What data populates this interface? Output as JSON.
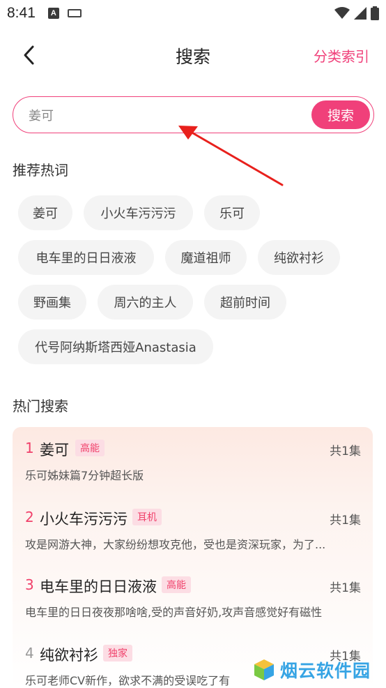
{
  "status_bar": {
    "time": "8:41"
  },
  "header": {
    "title": "搜索",
    "right_link": "分类索引"
  },
  "search": {
    "query": "姜可",
    "button": "搜索"
  },
  "recommended": {
    "title": "推荐热词",
    "tags": [
      "姜可",
      "小火车污污污",
      "乐可",
      "电车里的日日液液",
      "魔道祖师",
      "纯欲衬衫",
      "野画集",
      "周六的主人",
      "超前时间",
      "代号阿纳斯塔西娅Anastasia"
    ]
  },
  "hot": {
    "title": "热门搜索",
    "items": [
      {
        "rank": "1",
        "title": "姜可",
        "badge": "高能",
        "count": "共1集",
        "desc": "乐可姊妹篇7分钟超长版"
      },
      {
        "rank": "2",
        "title": "小火车污污污",
        "badge": "耳机",
        "count": "共1集",
        "desc": "攻是网游大神，大家纷纷想攻克他，受也是资深玩家，为了..."
      },
      {
        "rank": "3",
        "title": "电车里的日日液液",
        "badge": "高能",
        "count": "共1集",
        "desc": "电车里的日日夜夜那啥啥,受的声音好奶,攻声音感觉好有磁性"
      },
      {
        "rank": "4",
        "title": "纯欲衬衫",
        "badge": "独家",
        "count": "共1集",
        "desc": "乐可老师CV新作，欲求不满的受误吃了有"
      }
    ]
  },
  "watermark": {
    "text": "烟云软件园"
  },
  "colors": {
    "accent": "#f0407a",
    "tag_bg": "#f4f4f4",
    "badge_bg": "#fcdde4"
  }
}
